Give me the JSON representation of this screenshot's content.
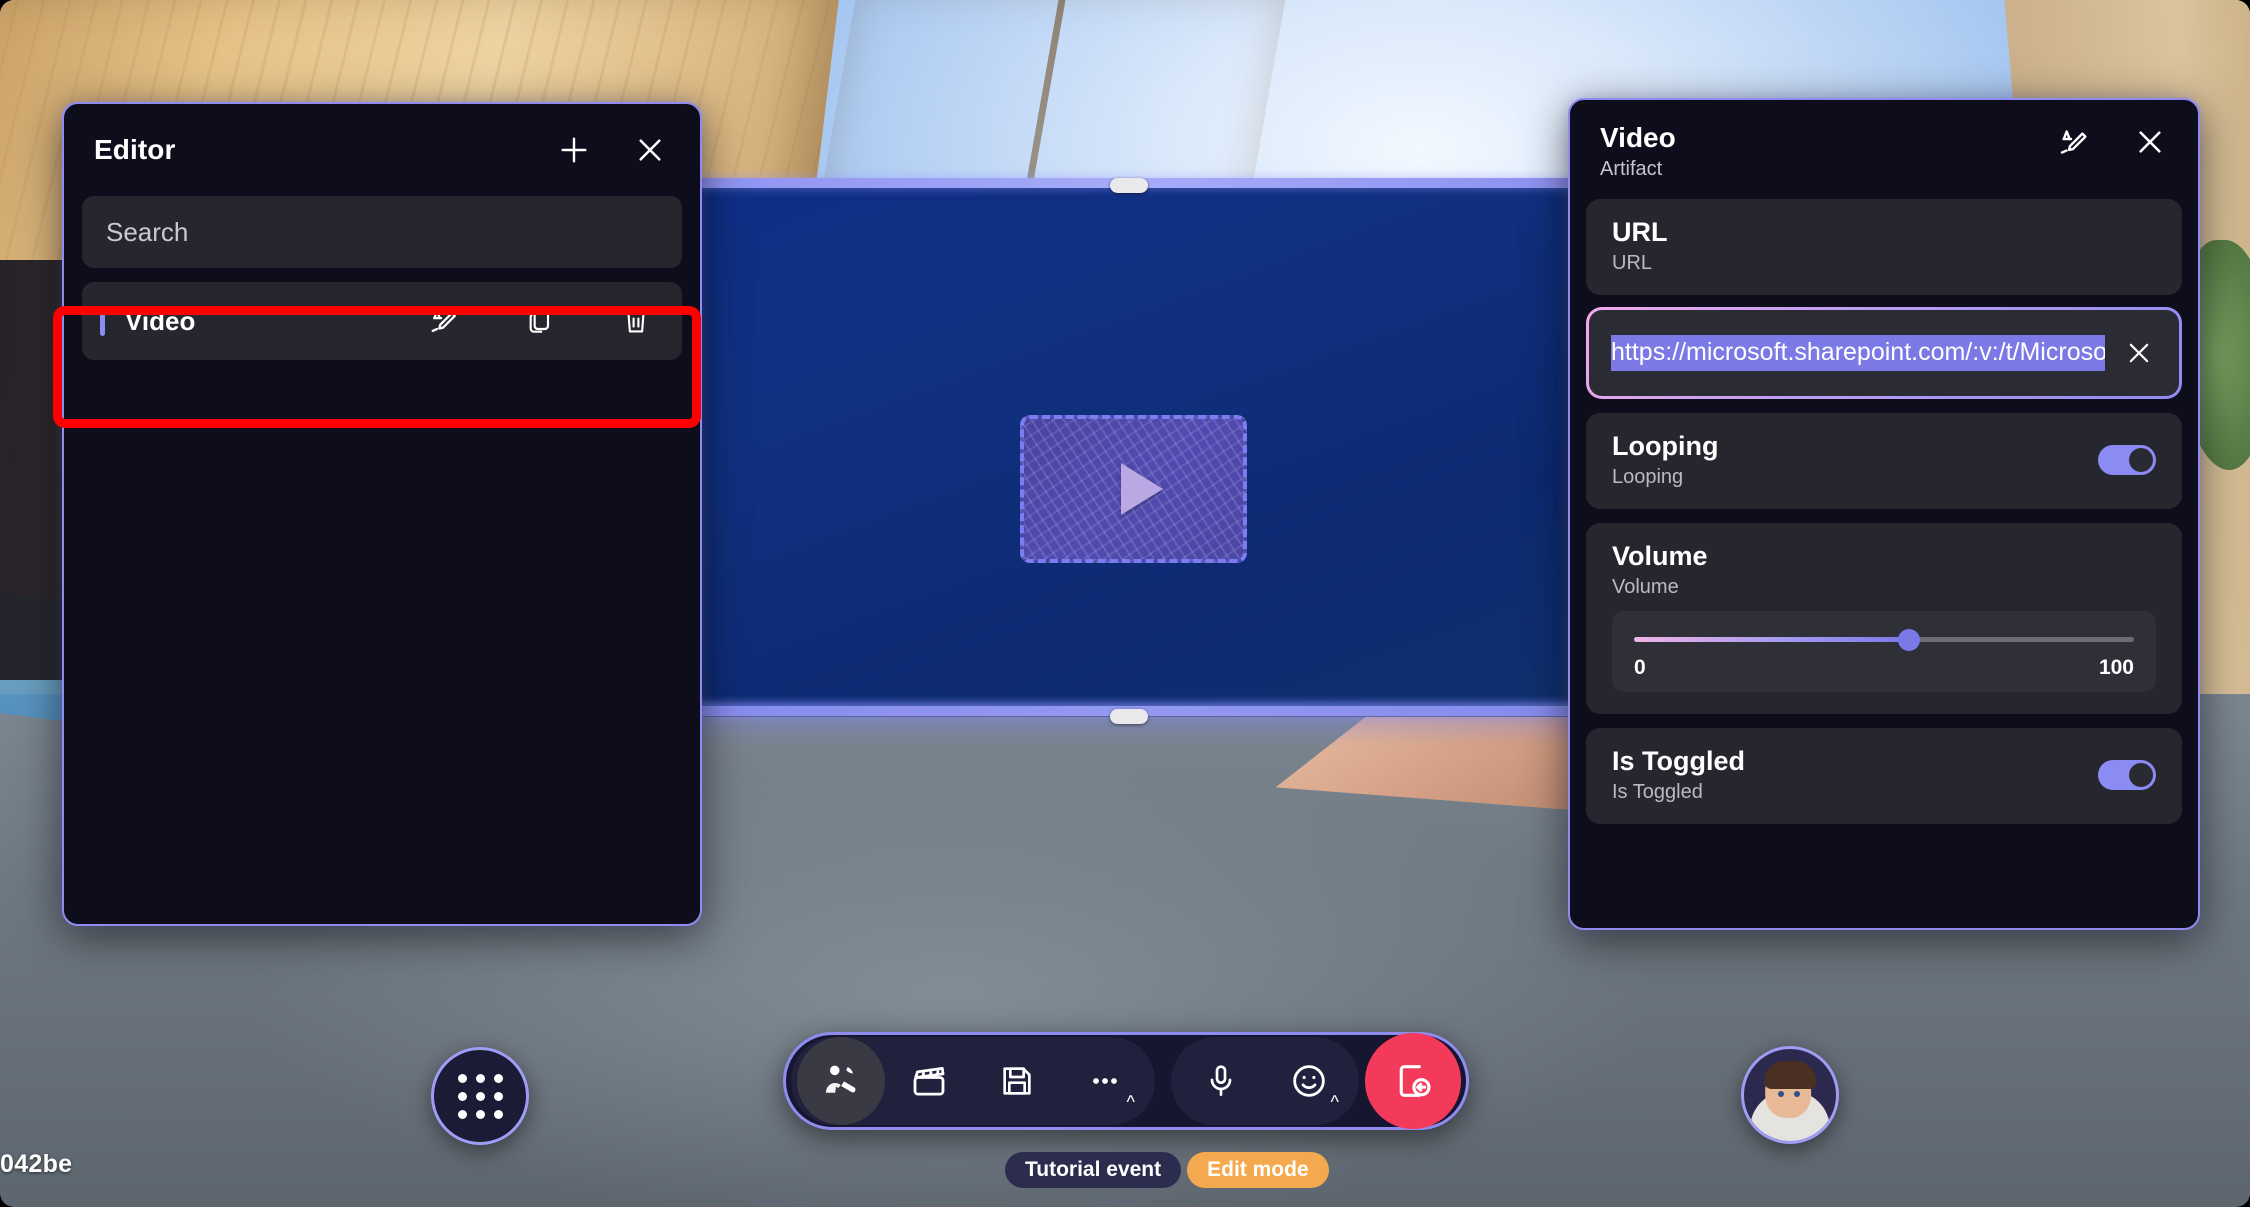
{
  "editor_panel": {
    "title": "Editor",
    "add_icon": "plus-icon",
    "close_icon": "close-icon",
    "search": {
      "placeholder": "Search",
      "value": ""
    },
    "items": [
      {
        "label": "Video",
        "actions": [
          {
            "name": "rename-icon",
            "label": "Rename"
          },
          {
            "name": "duplicate-icon",
            "label": "Duplicate"
          },
          {
            "name": "delete-icon",
            "label": "Delete"
          }
        ]
      }
    ]
  },
  "properties_panel": {
    "title": "Video",
    "subtitle": "Artifact",
    "rename_icon": "rename-icon",
    "close_icon": "close-icon",
    "properties": [
      {
        "name": "URL",
        "description": "URL",
        "type": "text",
        "value": "https://microsoft.sharepoint.com/:v:/t/Microsof",
        "selected": true,
        "clear_icon": "close-icon"
      },
      {
        "name": "Looping",
        "description": "Looping",
        "type": "toggle",
        "value": "on"
      },
      {
        "name": "Volume",
        "description": "Volume",
        "type": "slider",
        "min": "0",
        "max": "100",
        "value": 55
      },
      {
        "name": "Is Toggled",
        "description": "Is Toggled",
        "type": "toggle",
        "value": "on"
      }
    ]
  },
  "scene": {
    "video_placeholder": {
      "icon": "play-icon",
      "label": "Video placeholder"
    },
    "handles": [
      "top-resize-handle",
      "bottom-resize-handle"
    ]
  },
  "bottom_bar": {
    "app_launcher": {
      "icon": "grid-apps-icon",
      "label": "Apps"
    },
    "buttons": [
      {
        "icon": "people-reaction-icon",
        "label": "Participants",
        "active": true
      },
      {
        "icon": "clapperboard-icon",
        "label": "Scenes"
      },
      {
        "icon": "save-icon",
        "label": "Save"
      },
      {
        "icon": "more-icon",
        "label": "More",
        "chevron": "^"
      },
      {
        "icon": "microphone-icon",
        "label": "Mute"
      },
      {
        "icon": "emoji-icon",
        "label": "Reactions",
        "chevron": "^"
      },
      {
        "icon": "leave-icon",
        "label": "Leave"
      }
    ],
    "badges": [
      {
        "label": "Tutorial event",
        "style": "event"
      },
      {
        "label": "Edit mode",
        "style": "mode"
      }
    ],
    "avatar": {
      "label": "avatar"
    }
  },
  "overlay": {
    "corner_text": "042be",
    "highlight_color": "#ff0000",
    "highlight_target": "Video list row"
  },
  "colors": {
    "panel_border": "#8f8bf0",
    "panel_bg": "#0d0d1c",
    "card_bg": "#26262e",
    "accent": "#8b8bf4",
    "leave_button": "#f43a5a",
    "edit_mode_badge": "#f5a94e",
    "selection": "#7b79e6"
  }
}
